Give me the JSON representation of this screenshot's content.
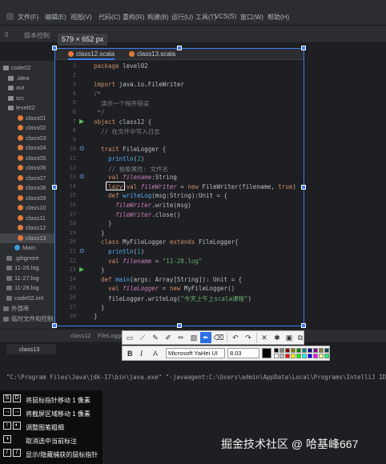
{
  "menubar": {
    "items": [
      "文件(F)",
      "编辑(E)",
      "视图(V)",
      "代码(C)",
      "重构(R)",
      "构建(B)",
      "运行(U)",
      "工具(T)",
      "VCS(S)",
      "窗口(W)",
      "帮助(H)"
    ]
  },
  "secondbar": {
    "left": "0",
    "label": "版本控制"
  },
  "capture": {
    "size_label": "579 × 652 px"
  },
  "tree": {
    "items": [
      {
        "label": "code02",
        "type": "root"
      },
      {
        "label": ".idea",
        "type": "folder"
      },
      {
        "label": "out",
        "type": "folder"
      },
      {
        "label": "src",
        "type": "folder"
      },
      {
        "label": "level02",
        "type": "folder"
      },
      {
        "label": "class01",
        "type": "scala"
      },
      {
        "label": "class02",
        "type": "scala"
      },
      {
        "label": "class03",
        "type": "scala"
      },
      {
        "label": "class04",
        "type": "scala"
      },
      {
        "label": "class05",
        "type": "scala"
      },
      {
        "label": "class06",
        "type": "scala"
      },
      {
        "label": "class07",
        "type": "scala"
      },
      {
        "label": "class08",
        "type": "scala"
      },
      {
        "label": "class09",
        "type": "scala"
      },
      {
        "label": "class10",
        "type": "scala"
      },
      {
        "label": "class11",
        "type": "scala"
      },
      {
        "label": "class12",
        "type": "scala"
      },
      {
        "label": "class13",
        "type": "scala"
      },
      {
        "label": "Main",
        "type": "main"
      },
      {
        "label": ".gitignore",
        "type": "file"
      },
      {
        "label": "11-26.log",
        "type": "file"
      },
      {
        "label": "11-27.log",
        "type": "file"
      },
      {
        "label": "11-28.log",
        "type": "file"
      },
      {
        "label": "code02.iml",
        "type": "file"
      },
      {
        "label": "外部库",
        "type": "lib"
      },
      {
        "label": "临时文件和控制台",
        "type": "lib"
      }
    ]
  },
  "editor": {
    "tabs": [
      {
        "label": "class12.scala",
        "active": true
      },
      {
        "label": "class13.scala",
        "active": false
      }
    ],
    "line_numbers": [
      "1",
      "2",
      "3",
      "4",
      "5",
      "6",
      "7",
      "8",
      "9",
      "10",
      "11",
      "12",
      "13",
      "14",
      "15",
      "16",
      "17",
      "18",
      "19",
      "20",
      "21",
      "22",
      "23",
      "24",
      "25",
      "26",
      "27",
      "28"
    ],
    "lines": [
      [
        {
          "t": "package ",
          "c": "kw"
        },
        {
          "t": "level02",
          "c": ""
        }
      ],
      [],
      [
        {
          "t": "import ",
          "c": "kw"
        },
        {
          "t": "java.io.FileWriter",
          "c": ""
        }
      ],
      [
        {
          "t": "/*",
          "c": "cm"
        }
      ],
      [
        {
          "t": "  演示一个程序错误",
          "c": "cm"
        }
      ],
      [
        {
          "t": " */",
          "c": "cm"
        }
      ],
      [
        {
          "t": "object ",
          "c": "kw"
        },
        {
          "t": "class12 {",
          "c": ""
        }
      ],
      [
        {
          "t": "  // 在文件中写入日志",
          "c": "cm"
        }
      ],
      [],
      [
        {
          "t": "  trait ",
          "c": "kw"
        },
        {
          "t": "FileLogger {",
          "c": ""
        }
      ],
      [
        {
          "t": "    ",
          "c": ""
        },
        {
          "t": "println",
          "c": "fn"
        },
        {
          "t": "(",
          "c": ""
        },
        {
          "t": "2",
          "c": "num"
        },
        {
          "t": ")",
          "c": ""
        }
      ],
      [
        {
          "t": "    // 抽象属性: 文件名",
          "c": "cm"
        }
      ],
      [
        {
          "t": "    val ",
          "c": "kw"
        },
        {
          "t": "filename",
          "c": "fld"
        },
        {
          "t": ":String",
          "c": ""
        }
      ],
      [
        {
          "t": "    lazy ",
          "c": "kw"
        },
        {
          "t": "val ",
          "c": "kw"
        },
        {
          "t": "fileWriter",
          "c": "fld"
        },
        {
          "t": " = ",
          "c": ""
        },
        {
          "t": "new ",
          "c": "kw"
        },
        {
          "t": "FileWriter(filename, ",
          "c": ""
        },
        {
          "t": "true",
          "c": "kw"
        },
        {
          "t": ")",
          "c": ""
        }
      ],
      [
        {
          "t": "    def ",
          "c": "kw"
        },
        {
          "t": "writeLog",
          "c": "fn"
        },
        {
          "t": "(msg:String):Unit = {",
          "c": ""
        }
      ],
      [
        {
          "t": "      ",
          "c": ""
        },
        {
          "t": "fileWriter",
          "c": "fld"
        },
        {
          "t": ".write(msg)",
          "c": ""
        }
      ],
      [
        {
          "t": "      ",
          "c": ""
        },
        {
          "t": "fileWriter",
          "c": "fld"
        },
        {
          "t": ".close()",
          "c": ""
        }
      ],
      [
        {
          "t": "    }",
          "c": ""
        }
      ],
      [
        {
          "t": "  }",
          "c": ""
        }
      ],
      [
        {
          "t": "  class ",
          "c": "kw"
        },
        {
          "t": "MyFileLogger ",
          "c": ""
        },
        {
          "t": "extends ",
          "c": "kw"
        },
        {
          "t": "FileLogger{",
          "c": ""
        }
      ],
      [
        {
          "t": "    ",
          "c": ""
        },
        {
          "t": "println",
          "c": "fn"
        },
        {
          "t": "(",
          "c": ""
        },
        {
          "t": "1",
          "c": "num"
        },
        {
          "t": ")",
          "c": ""
        }
      ],
      [
        {
          "t": "    val ",
          "c": "kw"
        },
        {
          "t": "filename",
          "c": "fld"
        },
        {
          "t": " = ",
          "c": ""
        },
        {
          "t": "\"11-28.log\"",
          "c": "str"
        }
      ],
      [
        {
          "t": "  }",
          "c": ""
        }
      ],
      [
        {
          "t": "  def ",
          "c": "kw"
        },
        {
          "t": "main",
          "c": "fn"
        },
        {
          "t": "(args: Array[String]): Unit = {",
          "c": ""
        }
      ],
      [
        {
          "t": "    val ",
          "c": "kw"
        },
        {
          "t": "fileLogger",
          "c": "fld"
        },
        {
          "t": " = ",
          "c": ""
        },
        {
          "t": "new ",
          "c": "kw"
        },
        {
          "t": "MyFileLogger()",
          "c": ""
        }
      ],
      [
        {
          "t": "    fileLogger.writeLog(",
          "c": ""
        },
        {
          "t": "\"今天上午上scala课程\"",
          "c": "str"
        },
        {
          "t": ")",
          "c": ""
        }
      ],
      [
        {
          "t": "  }",
          "c": ""
        }
      ],
      [
        {
          "t": "}",
          "c": ""
        }
      ]
    ]
  },
  "bottom": {
    "strip_labels": [
      "class12",
      "FileLogger"
    ],
    "run_tab": "class13",
    "run_line": "\"C:\\Program Files\\Java\\jdk-17\\bin\\java.exe\" \"-javaagent:C:\\Users\\admin\\AppData\\Local\\Programs\\IntelliJ IDEA Ulti"
  },
  "toolbar": {
    "font_name": "Microsoft YaHei UI",
    "font_size": "8.03",
    "bold_label": "B",
    "italic_label": "I",
    "text_label": "A"
  },
  "shortcuts": [
    {
      "keys": [
        "S",
        "D"
      ],
      "text": "将鼠标指针移动 1 像素"
    },
    {
      "keys": [
        "→",
        "→"
      ],
      "text": "将截屏区域移动 1 像素"
    },
    {
      "keys": [
        "↑",
        "◐"
      ],
      "text": "调整图笔粗细"
    },
    {
      "keys": [
        "◑"
      ],
      "text": "取消选中当前标注"
    },
    {
      "keys": [
        "/",
        "/"
      ],
      "text": "显示/隐藏捕获的鼠标指针"
    }
  ],
  "watermark": "掘金技术社区 @ 哈基峰667",
  "colors": {
    "accent": "#3d7cf5",
    "keyword": "#cf8e6d",
    "comment": "#7a7e85",
    "string": "#6aab73",
    "number": "#2aacb8",
    "field": "#c77dbb",
    "function": "#56a8f5"
  }
}
